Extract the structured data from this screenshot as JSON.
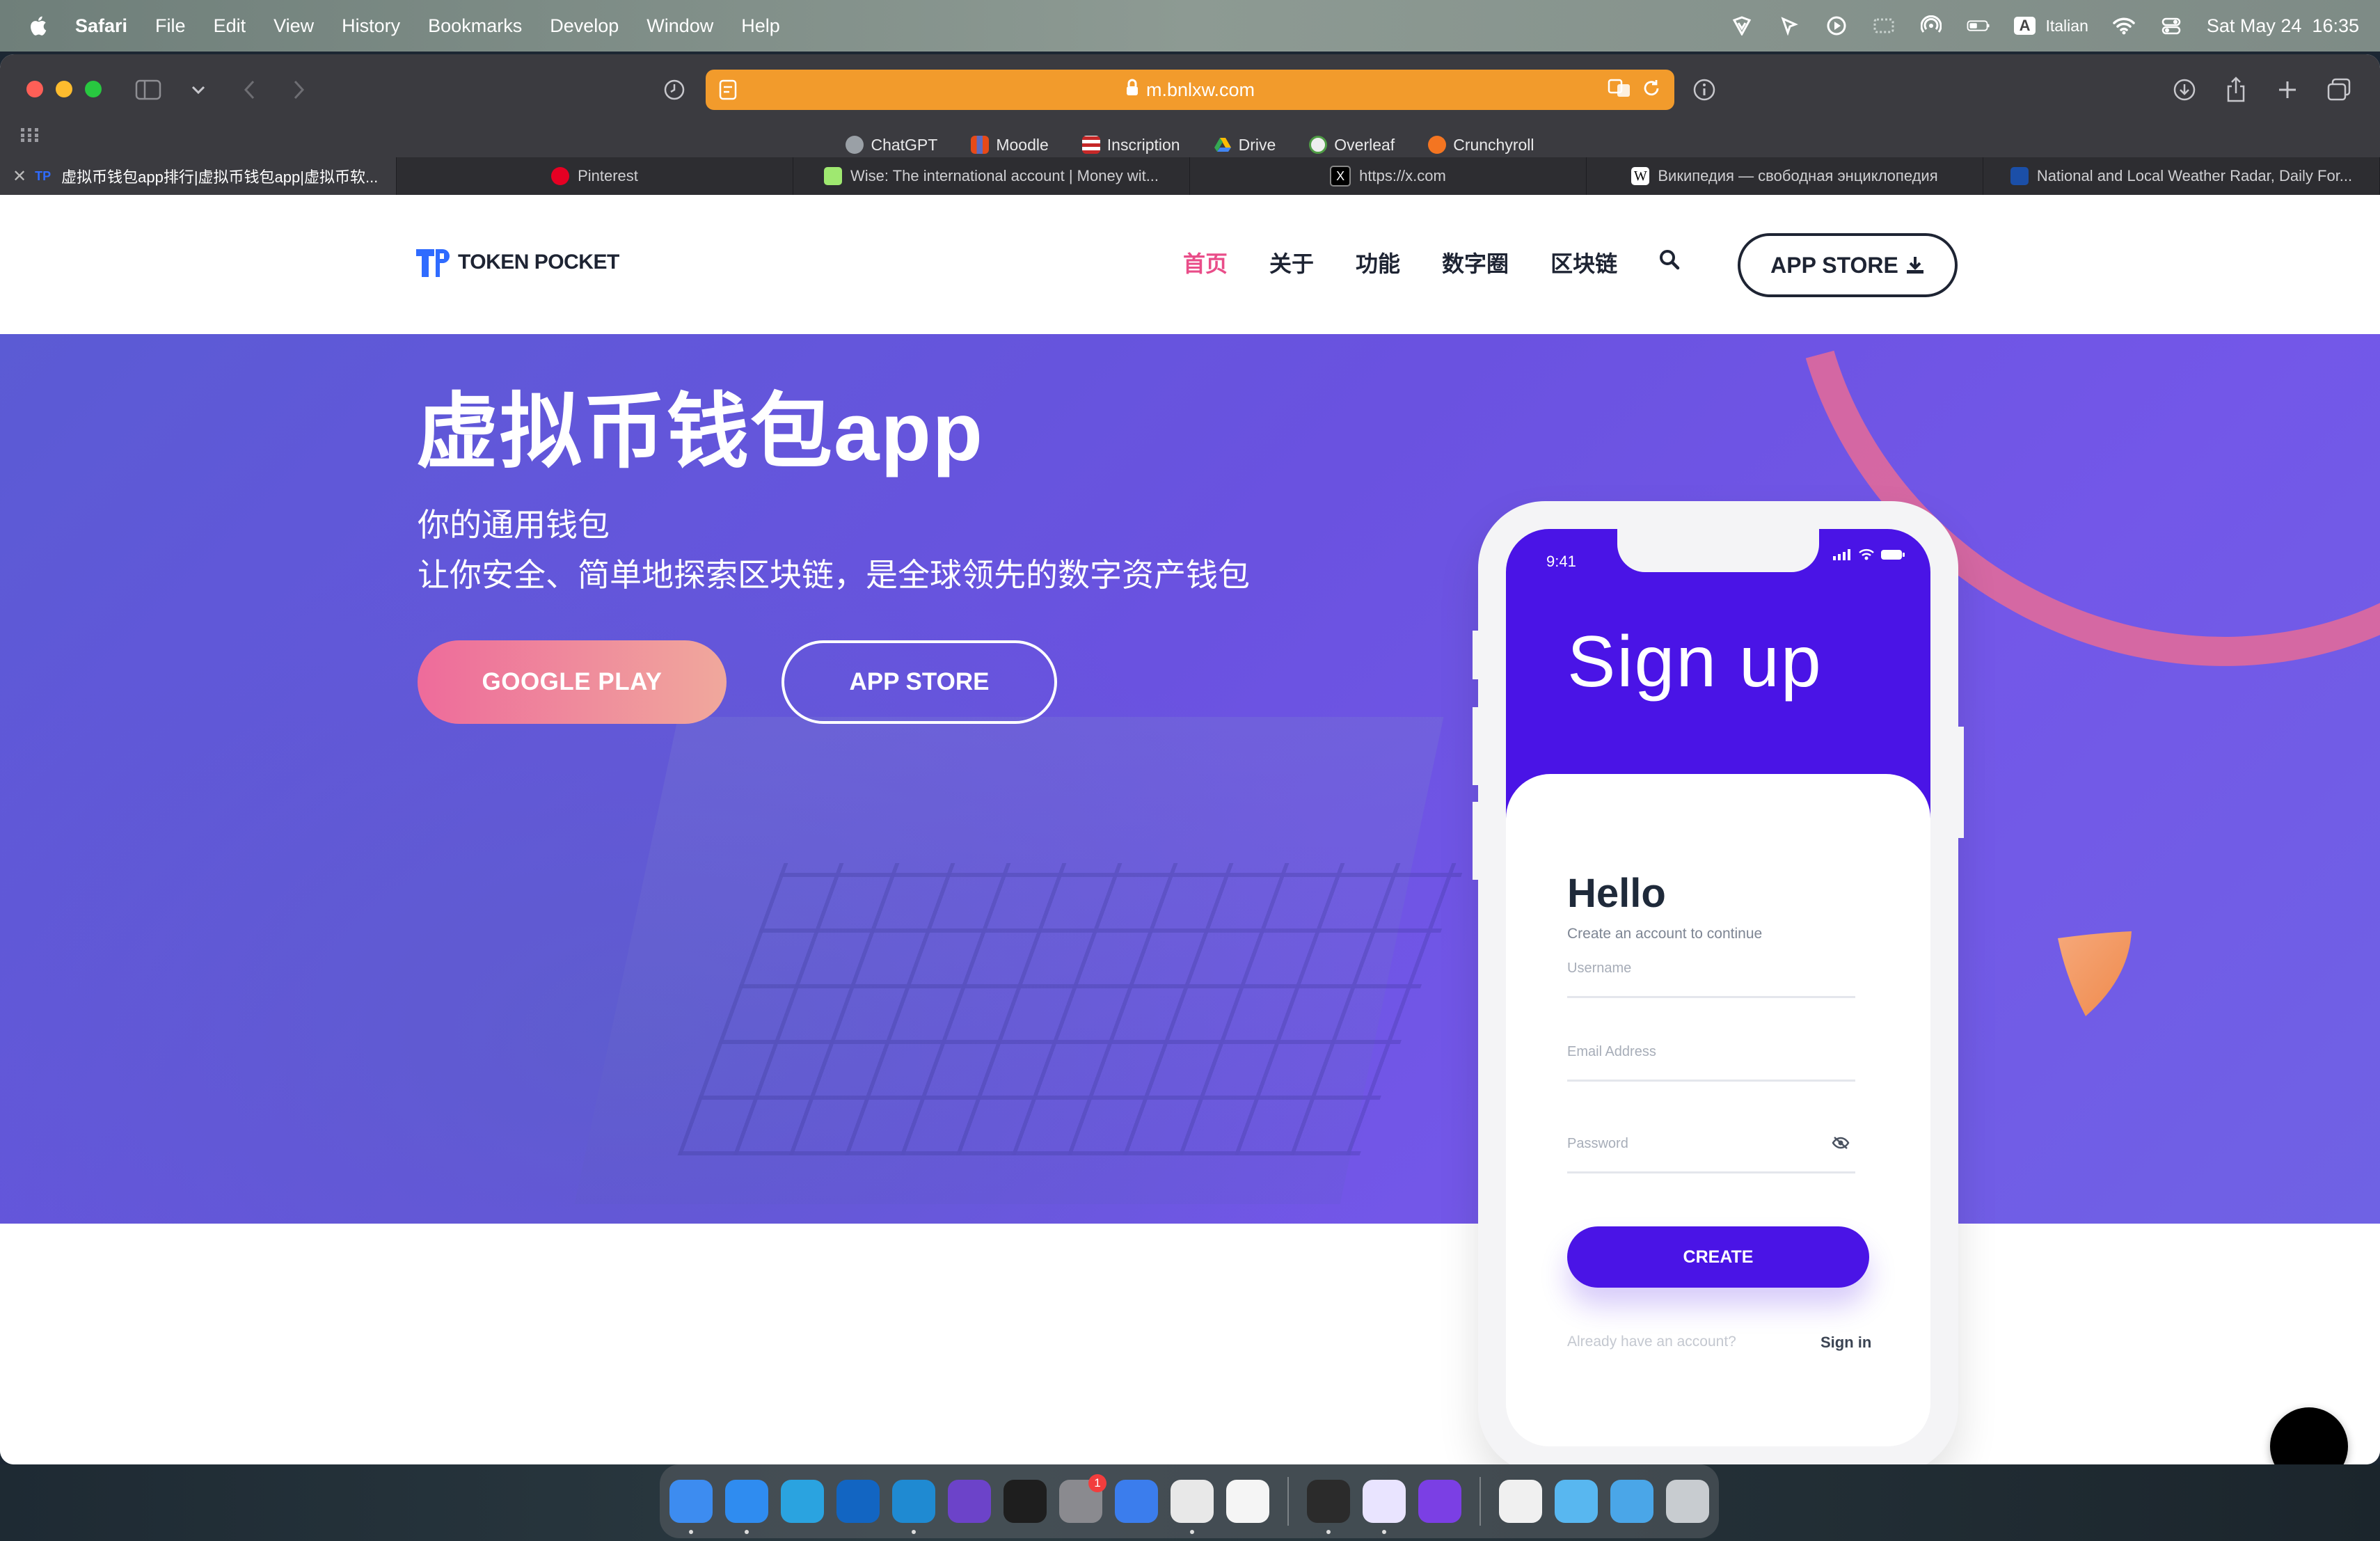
{
  "menubar": {
    "app": "Safari",
    "items": [
      "File",
      "Edit",
      "View",
      "History",
      "Bookmarks",
      "Develop",
      "Window",
      "Help"
    ],
    "input_source_badge": "A",
    "input_source": "Italian",
    "datetime": "Sat May 24  16:35"
  },
  "browser": {
    "url": "m.bnlxw.com",
    "favorites": [
      {
        "label": "ChatGPT",
        "color": "#9aa0a6"
      },
      {
        "label": "Moodle",
        "color": "#e64a19"
      },
      {
        "label": "Inscription",
        "color": "#c62828"
      },
      {
        "label": "Drive",
        "color": "#34a853"
      },
      {
        "label": "Overleaf",
        "color": "#eeeeee"
      },
      {
        "label": "Crunchyroll",
        "color": "#f47521"
      }
    ],
    "tabs": [
      {
        "label": "虚拟币钱包app排行|虚拟币钱包app|虚拟币软...",
        "icon": "TP",
        "color": "#2f6bff"
      },
      {
        "label": "Pinterest",
        "icon": "P",
        "color": "#e60023"
      },
      {
        "label": "Wise: The international account | Money wit...",
        "icon": "7",
        "color": "#9fe870"
      },
      {
        "label": "https://x.com",
        "icon": "X",
        "color": "#000000"
      },
      {
        "label": "Википедия — свободная энциклопедия",
        "icon": "W",
        "color": "#ffffff"
      },
      {
        "label": "National and Local Weather Radar, Daily For...",
        "icon": "TWC",
        "color": "#1b4fa8"
      }
    ]
  },
  "site": {
    "logo_text": "TOKEN POCKET",
    "nav": [
      "首页",
      "关于",
      "功能",
      "数字圈",
      "区块链"
    ],
    "nav_cta": "APP STORE",
    "hero_title": "虚拟币钱包app",
    "hero_sub1": "你的通用钱包",
    "hero_sub2": "让你安全、简单地探索区块链，是全球领先的数字资产钱包",
    "btn_google": "GOOGLE PLAY",
    "btn_appstore": "APP STORE",
    "colors": {
      "accent_pink": "#e94d89",
      "hero_purple": "#6a52e0",
      "phone_purple": "#4a14e6"
    }
  },
  "phone": {
    "time": "9:41",
    "title": "Sign up",
    "hello": "Hello",
    "hello_sub": "Create an account to continue",
    "fields": [
      "Username",
      "Email Address",
      "Password"
    ],
    "create": "CREATE",
    "have_account": "Already have an account?",
    "sign_in": "Sign in"
  },
  "dock": {
    "apps": [
      {
        "name": "finder",
        "color": "#3d8cf0",
        "running": true
      },
      {
        "name": "safari",
        "color": "#2f8cf0",
        "running": true
      },
      {
        "name": "telegram",
        "color": "#2aa3e0",
        "running": false
      },
      {
        "name": "outlook",
        "color": "#1265c2",
        "running": false
      },
      {
        "name": "vscode",
        "color": "#1f8ad2",
        "running": true
      },
      {
        "name": "obsidian",
        "color": "#6c43c9",
        "running": false
      },
      {
        "name": "figma",
        "color": "#1e1e1e",
        "running": false
      },
      {
        "name": "system-settings",
        "color": "#8a8a8f",
        "running": false,
        "badge": "1"
      },
      {
        "name": "google-docs",
        "color": "#3b7ded",
        "running": false
      },
      {
        "name": "chrome",
        "color": "#e8e8e8",
        "running": true
      },
      {
        "name": "moodle",
        "color": "#f5f5f5",
        "running": false
      },
      {
        "name": "activity-monitor",
        "color": "#2b2b2b",
        "running": true
      },
      {
        "name": "proton-vpn",
        "color": "#e9e4ff",
        "running": true
      },
      {
        "name": "firefox",
        "color": "#7b3fe4",
        "running": false
      },
      {
        "name": "document",
        "color": "#f0f0f0",
        "running": false
      },
      {
        "name": "folder",
        "color": "#58b7f0",
        "running": false
      },
      {
        "name": "downloads-folder",
        "color": "#4aa6e8",
        "running": false
      },
      {
        "name": "trash",
        "color": "#c8ccd0",
        "running": false
      }
    ]
  }
}
